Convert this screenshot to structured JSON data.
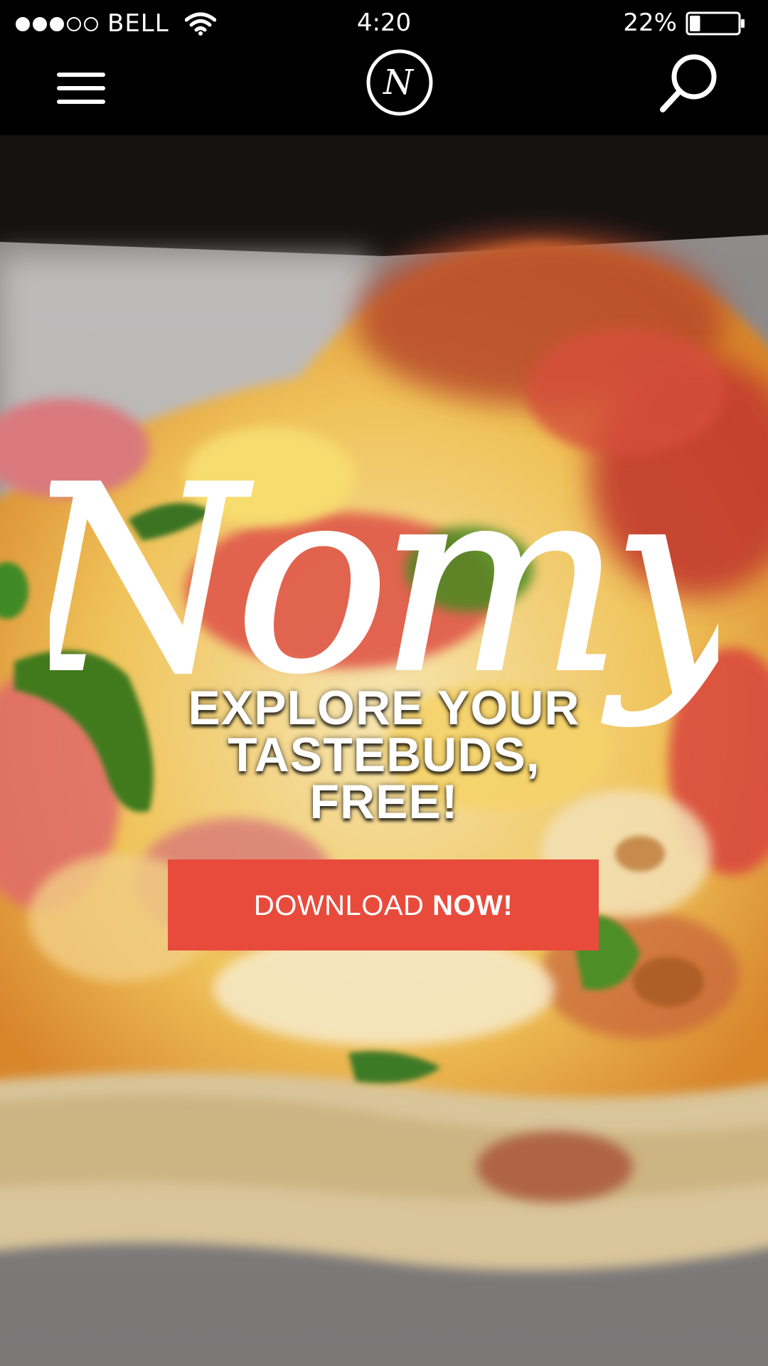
{
  "status_bar": {
    "carrier": "BELL",
    "time": "4:20",
    "battery_percent": "22%",
    "battery_level": 0.22,
    "signal_bars_filled": 3,
    "signal_bars_total": 5,
    "wifi_icon": "wifi-icon"
  },
  "nav": {
    "menu_icon": "hamburger-menu-icon",
    "logo_letter": "N",
    "search_icon": "search-icon"
  },
  "hero": {
    "background": "pizza-slice-photo",
    "brand_name": "Nomy",
    "tagline": "EXPLORE YOUR\nTASTEBUDS,\nFREE!",
    "cta": {
      "label_regular": "DOWNLOAD",
      "label_bold": "NOW!",
      "color": "#e84b3c"
    }
  }
}
